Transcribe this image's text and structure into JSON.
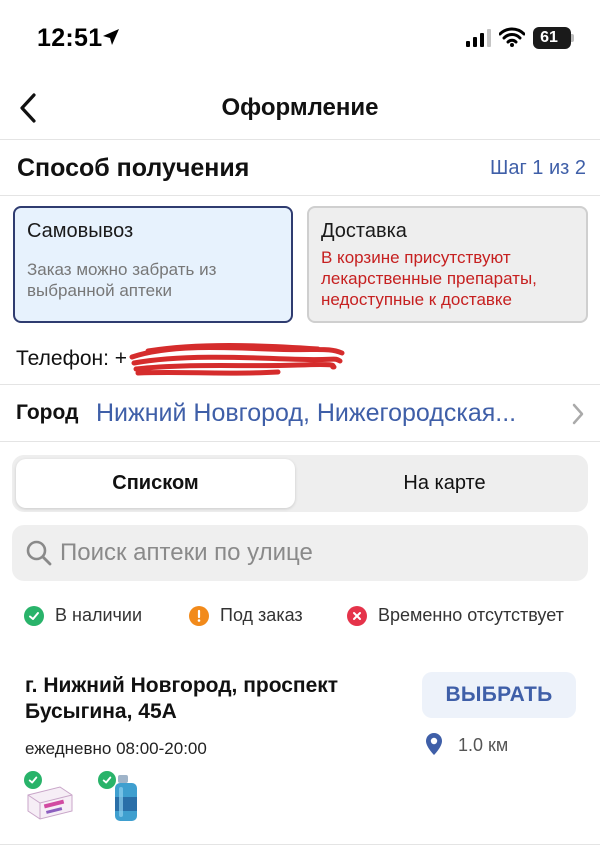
{
  "status_bar": {
    "time": "12:51",
    "battery": "61"
  },
  "nav": {
    "title": "Оформление"
  },
  "section": {
    "title": "Способ получения",
    "step": "Шаг 1 из 2"
  },
  "delivery_options": {
    "pickup": {
      "title": "Самовывоз",
      "description": "Заказ можно забрать из выбранной аптеки",
      "selected": true
    },
    "delivery": {
      "title": "Доставка",
      "warning": "В корзине присутствуют лекарственные препараты, недоступные к доставке",
      "selected": false
    }
  },
  "phone": {
    "label": "Телефон: +"
  },
  "city": {
    "label": "Город",
    "value": "Нижний Новгород, Нижегородская..."
  },
  "view_toggle": {
    "list": "Списком",
    "map": "На карте",
    "active": "list"
  },
  "search": {
    "placeholder": "Поиск аптеки по улице",
    "value": ""
  },
  "legend": [
    {
      "label": "В наличии",
      "icon": "check-icon",
      "color": "#29b36a"
    },
    {
      "label": "Под заказ",
      "icon": "exclamation-icon",
      "color": "#f28a1a"
    },
    {
      "label": "Временно отсутствует",
      "icon": "cross-icon",
      "color": "#e5334a"
    }
  ],
  "pharmacy": {
    "address": "г. Нижний Новгород, проспект Бусыгина, 45А",
    "hours": "ежедневно 08:00-20:00",
    "button": "ВЫБРАТЬ",
    "distance": "1.0 км"
  },
  "colors": {
    "accent": "#3f5fa8",
    "selected_bg": "#e7f2fd",
    "selected_border": "#2f3c70",
    "warning": "#c62020"
  }
}
